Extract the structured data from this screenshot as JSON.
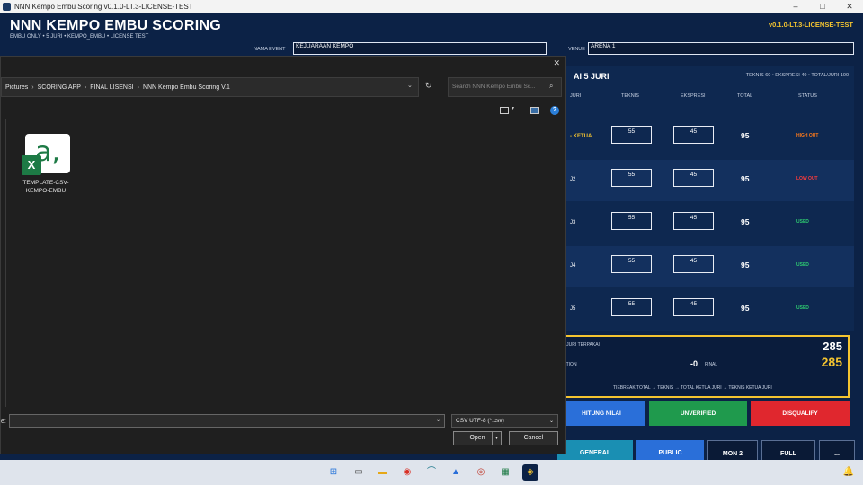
{
  "window": {
    "title": "NNN Kempo Embu Scoring v0.1.0-LT.3-LICENSE-TEST",
    "min": "–",
    "max": "□",
    "close": "✕"
  },
  "app": {
    "title": "NNN KEMPO EMBU SCORING",
    "subtitle": "EMBU ONLY • 5 JURI • KEMPO_EMBU • LICENSE TEST",
    "version": "v0.1.0-LT.3-LICENSE-TEST",
    "event_label": "NAMA EVENT",
    "event_value": "KEJUARAAN KEMPO",
    "venue_label": "VENUE",
    "venue_value": "ARENA 1"
  },
  "panel": {
    "title": "AI 5 JURI",
    "info": "TEKNIS 60 • EKSPRESI 40 • TOTAL/JURI 100",
    "headers": {
      "juri": "JURI",
      "teknis": "TEKNIS",
      "ekspresi": "EKSPRESI",
      "total": "TOTAL",
      "status": "STATUS"
    },
    "rows": [
      {
        "name": "- KETUA",
        "teknis": "55",
        "ekspresi": "45",
        "total": "95",
        "status": "HIGH OUT"
      },
      {
        "name": "J2",
        "teknis": "55",
        "ekspresi": "45",
        "total": "95",
        "status": "LOW OUT"
      },
      {
        "name": "J3",
        "teknis": "55",
        "ekspresi": "45",
        "total": "95",
        "status": "USED"
      },
      {
        "name": "J4",
        "teknis": "55",
        "ekspresi": "45",
        "total": "95",
        "status": "USED"
      },
      {
        "name": "J5",
        "teknis": "55",
        "ekspresi": "45",
        "total": "95",
        "status": "USED"
      }
    ]
  },
  "summary": {
    "label1": "3 JURI TERPAKAI",
    "value1": "285",
    "label2": "CTION",
    "deduction": "-0",
    "final_label": "FINAL",
    "final_value": "285",
    "tiebreak": "TIEBREAK TOTAL → TEKNIS → TOTAL KETUA JURI → TEKNIS KETUA JURI"
  },
  "actions": {
    "hitung": "HITUNG NILAI",
    "unverified": "UNVERIFIED",
    "disqualify": "DISQUALIFY"
  },
  "bottom": {
    "general": "GENERAL",
    "public": "PUBLIC",
    "mon2": "MON 2",
    "full": "FULL",
    "more": "..."
  },
  "dialog": {
    "close": "✕",
    "breadcrumb": [
      "Pictures",
      "SCORING APP",
      "FINAL LISENSI",
      "NNN Kempo Embu Scoring V.1"
    ],
    "search_placeholder": "Search NNN Kempo Embu Sc...",
    "file_name": "TEMPLATE-CSV-KEMPO-EMBU",
    "file_name_label": "e:",
    "file_name_value": "",
    "file_type": "CSV UTF-8 (*.csv)",
    "open": "Open",
    "cancel": "Cancel"
  },
  "colors": {
    "accent": "#f4c430",
    "hitung": "#2a6fd9",
    "unverified": "#1f9a4d",
    "disqualify": "#e0272e",
    "general": "#1a8fb3",
    "public": "#2a6fd9",
    "high_out": "#ff7a1a",
    "low_out": "#ff3b3b",
    "used": "#2ecc71"
  }
}
